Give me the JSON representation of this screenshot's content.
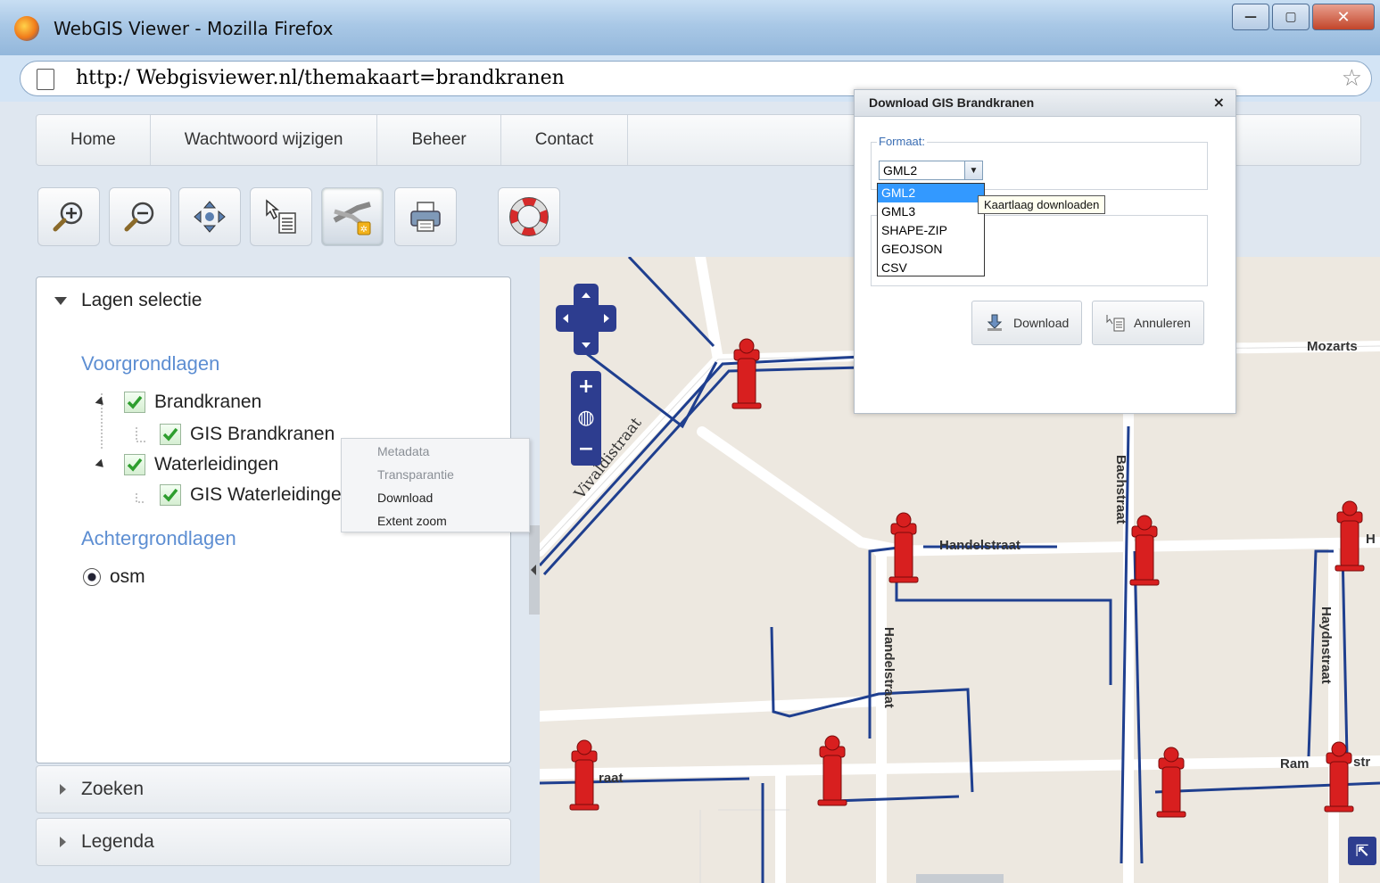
{
  "window": {
    "title": "WebGIS Viewer - Mozilla Firefox",
    "url": "http:/ Webgisviewer.nl/themakaart=brandkranen"
  },
  "menu": {
    "items": [
      {
        "label": "Home"
      },
      {
        "label": "Wachtwoord wijzigen"
      },
      {
        "label": "Beheer"
      },
      {
        "label": "Contact"
      }
    ]
  },
  "toolbar": {
    "tools": [
      "zoom-in-icon",
      "zoom-out-icon",
      "pan-icon",
      "identify-icon",
      "download-layer-icon",
      "print-icon",
      "help-icon"
    ]
  },
  "layers_panel": {
    "title": "Lagen selectie",
    "foreground_label": "Voorgrondlagen",
    "background_label": "Achtergrondlagen",
    "groups": [
      {
        "label": "Brandkranen",
        "child": "GIS Brandkranen"
      },
      {
        "label": "Waterleidingen",
        "child": "GIS Waterleidingen"
      }
    ],
    "background_layer": "osm"
  },
  "accordions": {
    "search": "Zoeken",
    "legend": "Legenda"
  },
  "context_menu": {
    "items": [
      {
        "label": "Metadata",
        "enabled": false
      },
      {
        "label": "Transparantie",
        "enabled": false
      },
      {
        "label": "Download",
        "enabled": true
      },
      {
        "label": "Extent zoom",
        "enabled": true
      }
    ]
  },
  "dialog": {
    "title": "Download GIS Brandkranen",
    "close": "×",
    "format_legend": "Formaat:",
    "selected_format": "GML2",
    "options": [
      "GML2",
      "GML3",
      "SHAPE-ZIP",
      "GEOJSON",
      "CSV"
    ],
    "tooltip": "Kaartlaag downloaden",
    "download_button": "Download",
    "cancel_button": "Annuleren"
  },
  "map": {
    "streets": [
      "Vivaldistraat",
      "Bachstraat",
      "Handelstraat",
      "Handelstraat",
      "Haydnstraat",
      "Mozarts",
      "Ram",
      "str",
      "raat",
      "H"
    ],
    "colors": {
      "water_pipe": "#1f3f8f",
      "road": "#ffffff",
      "land": "#ede8e0",
      "hydrant": "#d81f1f",
      "control": "#2d3d8f"
    }
  }
}
